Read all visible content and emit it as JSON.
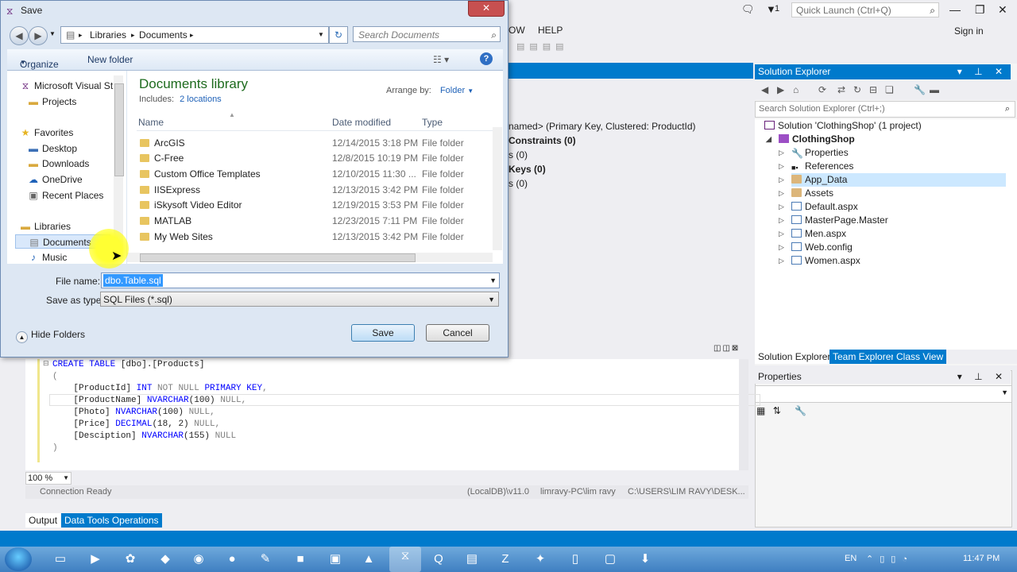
{
  "vs": {
    "quick_launch_placeholder": "Quick Launch (Ctrl+Q)",
    "notif_count": "1",
    "menu_partial": "OW",
    "menu_help": "HELP",
    "sign_in": "Sign in",
    "solution_explorer": {
      "title": "Solution Explorer",
      "search_placeholder": "Search Solution Explorer (Ctrl+;)",
      "solution": "Solution 'ClothingShop' (1 project)",
      "project": "ClothingShop",
      "items": [
        "Properties",
        "References",
        "App_Data",
        "Assets",
        "Default.aspx",
        "MasterPage.Master",
        "Men.aspx",
        "Web.config",
        "Women.aspx"
      ],
      "tabs": [
        "Solution Explorer",
        "Team Explorer",
        "Class View"
      ]
    },
    "properties_title": "Properties",
    "middle": {
      "line1": "named>   (Primary Key, Clustered: ProductId)",
      "line2": "Constraints (0)",
      "line3": "s (0)",
      "line4": "Keys (0)",
      "line5": "s (0)"
    },
    "code": {
      "l1_kw": "CREATE TABLE",
      "l1_id": " [dbo].[Products]",
      "l2": "(",
      "l3_id": "    [ProductId] ",
      "l3_ty": "INT",
      "l3_gr": " NOT NULL ",
      "l3_kw": "PRIMARY KEY",
      "l3_end": ",",
      "l4_id": "    [ProductName] ",
      "l4_ty": "NVARCHAR",
      "l4_args": "(100)",
      "l4_gr": " NULL",
      "l4_end": ",",
      "l5_id": "    [Photo] ",
      "l5_ty": "NVARCHAR",
      "l5_args": "(100)",
      "l5_gr": " NULL",
      "l5_end": ",",
      "l6_id": "    [Price] ",
      "l6_ty": "DECIMAL",
      "l6_args": "(18, 2)",
      "l6_gr": " NULL",
      "l6_end": ",",
      "l7_id": "    [Desciption] ",
      "l7_ty": "NVARCHAR",
      "l7_args": "(155)",
      "l7_gr": " NULL",
      "l8": ")"
    },
    "zoom": "100 %",
    "status": {
      "connection": "Connection Ready",
      "server": "(LocalDB)\\v11.0",
      "user": "limravy-PC\\lim ravy",
      "path": "C:\\USERS\\LIM RAVY\\DESK..."
    },
    "output_tabs": [
      "Output",
      "Data Tools Operations"
    ],
    "taskbar": {
      "lang": "EN",
      "clock": "11:47 PM"
    }
  },
  "dialog": {
    "title": "Save",
    "breadcrumb": [
      "Libraries",
      "Documents"
    ],
    "search_placeholder": "Search Documents",
    "organize": "Organize",
    "new_folder": "New folder",
    "nav": {
      "top": [
        "Microsoft Visual St",
        "Projects"
      ],
      "favorites": "Favorites",
      "fav_items": [
        "Desktop",
        "Downloads",
        "OneDrive",
        "Recent Places"
      ],
      "libraries": "Libraries",
      "lib_items": [
        "Documents",
        "Music"
      ]
    },
    "library_title": "Documents library",
    "includes_label": "Includes:",
    "includes_link": "2 locations",
    "arrange_label": "Arrange by:",
    "arrange_value": "Folder",
    "columns": [
      "Name",
      "Date modified",
      "Type"
    ],
    "files": [
      {
        "name": "ArcGIS",
        "date": "12/14/2015 3:18 PM",
        "type": "File folder"
      },
      {
        "name": "C-Free",
        "date": "12/8/2015 10:19 PM",
        "type": "File folder"
      },
      {
        "name": "Custom Office Templates",
        "date": "12/10/2015 11:30 ...",
        "type": "File folder"
      },
      {
        "name": "IISExpress",
        "date": "12/13/2015 3:42 PM",
        "type": "File folder"
      },
      {
        "name": "iSkysoft Video Editor",
        "date": "12/19/2015 3:53 PM",
        "type": "File folder"
      },
      {
        "name": "MATLAB",
        "date": "12/23/2015 7:11 PM",
        "type": "File folder"
      },
      {
        "name": "My Web Sites",
        "date": "12/13/2015 3:42 PM",
        "type": "File folder"
      }
    ],
    "file_name_label": "File name:",
    "file_name_value": "dbo.Table.sql",
    "save_as_type_label": "Save as type:",
    "save_as_type_value": "SQL Files (*.sql)",
    "hide_folders": "Hide Folders",
    "save_button": "Save",
    "cancel_button": "Cancel"
  }
}
